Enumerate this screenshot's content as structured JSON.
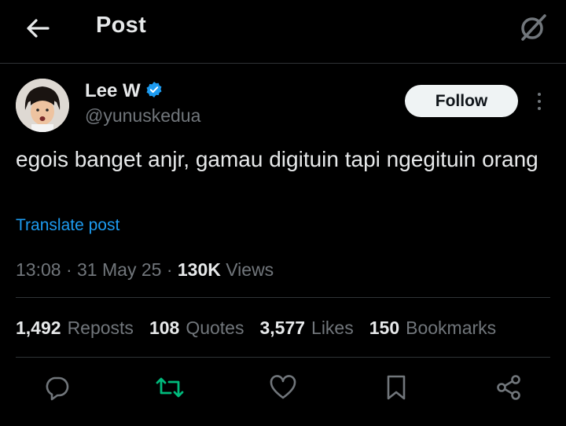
{
  "header": {
    "title": "Post"
  },
  "author": {
    "name": "Lee W",
    "handle": "@yunuskedua",
    "verified": true
  },
  "follow_label": "Follow",
  "post": {
    "text": "egois banget anjr, gamau digituin tapi ngegituin orang",
    "translate_label": "Translate post",
    "time": "13:08",
    "date": "31 May 25",
    "views_count": "130K",
    "views_label": "Views"
  },
  "stats": {
    "reposts_count": "1,492",
    "reposts_label": "Reposts",
    "quotes_count": "108",
    "quotes_label": "Quotes",
    "likes_count": "3,577",
    "likes_label": "Likes",
    "bookmarks_count": "150",
    "bookmarks_label": "Bookmarks"
  },
  "colors": {
    "accent": "#1d9bf0",
    "repost_active": "#00ba7c",
    "muted": "#71767b",
    "background": "#000000"
  },
  "icons": [
    "back-arrow-icon",
    "grok-icon",
    "verified-badge-icon",
    "more-icon",
    "reply-icon",
    "repost-icon",
    "like-icon",
    "bookmark-icon",
    "share-icon"
  ]
}
